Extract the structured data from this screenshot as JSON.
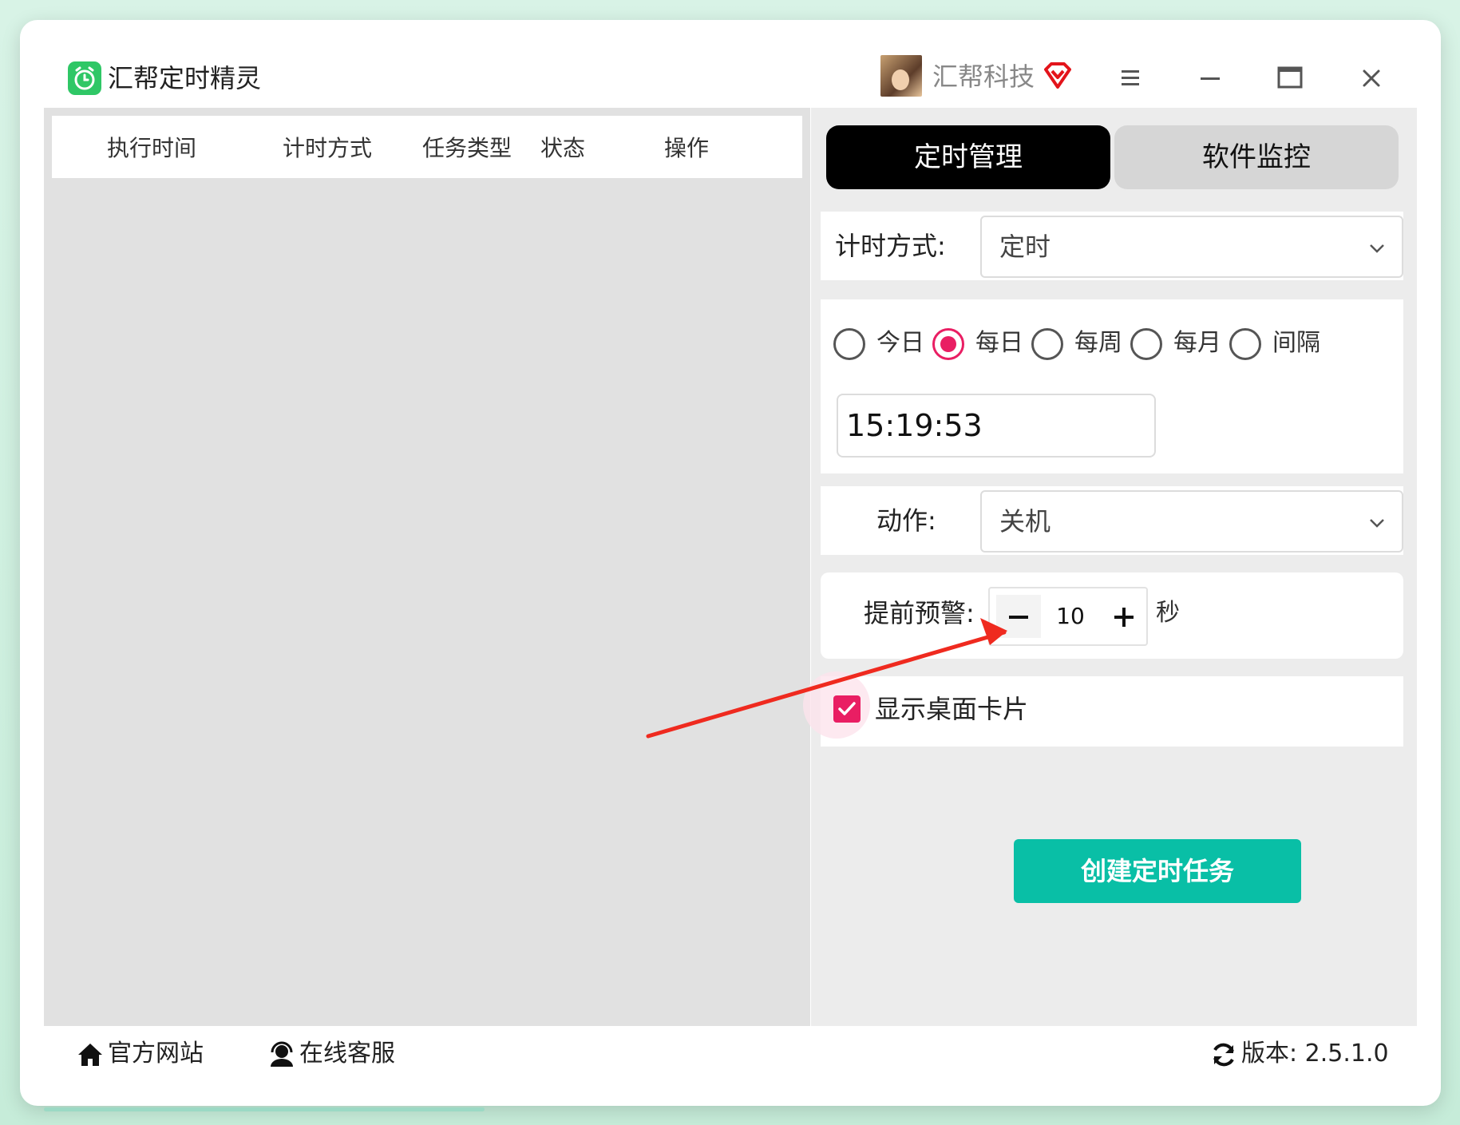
{
  "app": {
    "title": "汇帮定时精灵"
  },
  "user": {
    "name": "汇帮科技"
  },
  "table": {
    "headers": [
      "执行时间",
      "计时方式",
      "任务类型",
      "状态",
      "操作"
    ]
  },
  "tabs": [
    {
      "label": "定时管理",
      "active": true
    },
    {
      "label": "软件监控",
      "active": false
    }
  ],
  "form": {
    "mode_label": "计时方式:",
    "mode_value": "定时",
    "repeat_options": [
      {
        "label": "今日",
        "checked": false
      },
      {
        "label": "每日",
        "checked": true
      },
      {
        "label": "每周",
        "checked": false
      },
      {
        "label": "每月",
        "checked": false
      },
      {
        "label": "间隔",
        "checked": false
      }
    ],
    "time_value": "15:19:53",
    "action_label": "动作:",
    "action_value": "关机",
    "warn_label": "提前预警:",
    "warn_value": "10",
    "warn_unit": "秒",
    "show_card_label": "显示桌面卡片",
    "show_card_checked": true,
    "create_button": "创建定时任务"
  },
  "footer": {
    "website": "官方网站",
    "service": "在线客服",
    "version": "版本: 2.5.1.0"
  },
  "colors": {
    "accent_pink": "#e91e63",
    "create_button": "#09bfa6",
    "app_logo": "#2fc766",
    "tab_active_bg": "#000000"
  },
  "icons": [
    "app-logo-icon",
    "vip-diamond-icon",
    "menu-icon",
    "minimize-icon",
    "maximize-icon",
    "close-icon",
    "chevron-down-icon",
    "home-icon",
    "headset-icon",
    "refresh-icon",
    "check-icon"
  ]
}
